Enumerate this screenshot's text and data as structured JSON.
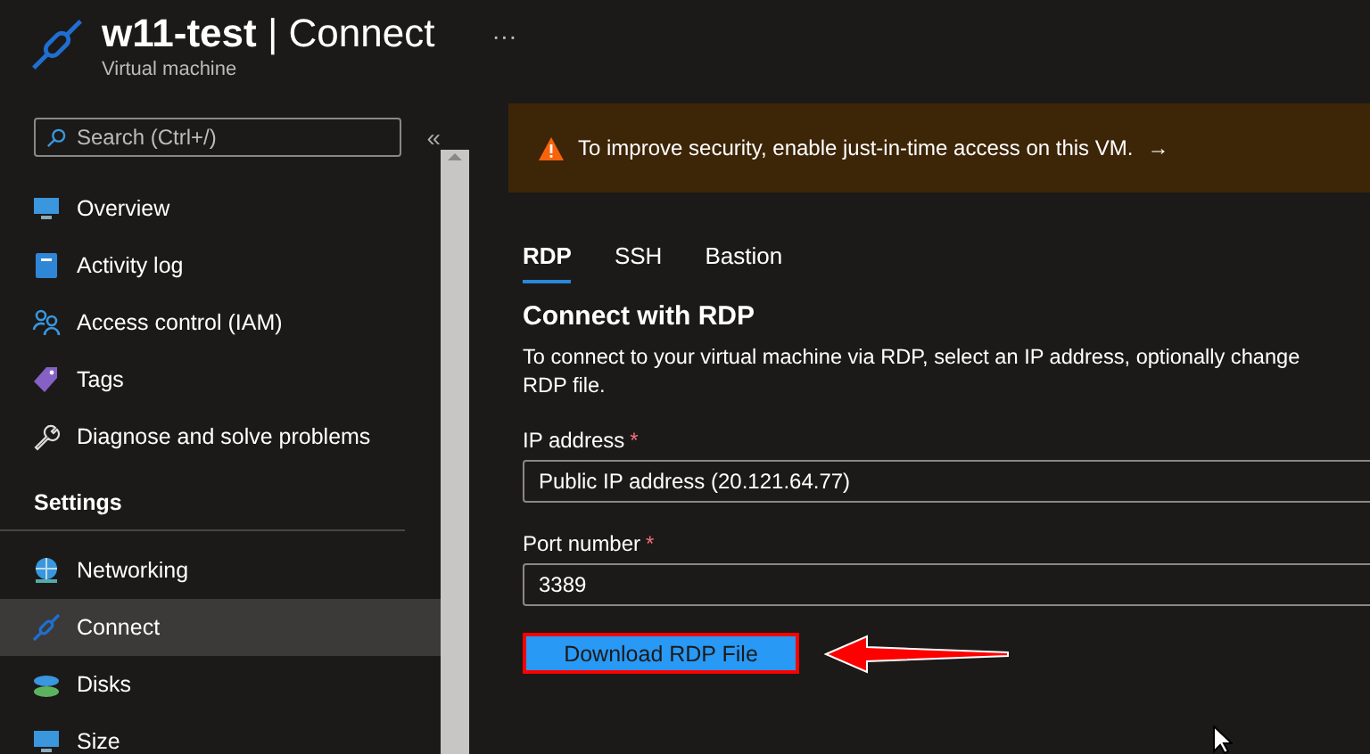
{
  "header": {
    "title": "w11-test",
    "separator": "|",
    "page": "Connect",
    "subtitle": "Virtual machine",
    "more": "···"
  },
  "sidebar": {
    "search": {
      "placeholder": "Search (Ctrl+/)"
    },
    "collapse": "«",
    "items": [
      {
        "kind": "item",
        "label": "Overview",
        "selected": false
      },
      {
        "kind": "item",
        "label": "Activity log",
        "selected": false
      },
      {
        "kind": "item",
        "label": "Access control (IAM)",
        "selected": false
      },
      {
        "kind": "item",
        "label": "Tags",
        "selected": false
      },
      {
        "kind": "item",
        "label": "Diagnose and solve problems",
        "selected": false
      },
      {
        "kind": "heading",
        "label": "Settings"
      },
      {
        "kind": "item",
        "label": "Networking",
        "selected": false
      },
      {
        "kind": "item",
        "label": "Connect",
        "selected": true
      },
      {
        "kind": "item",
        "label": "Disks",
        "selected": false
      },
      {
        "kind": "item",
        "label": "Size",
        "selected": false
      }
    ]
  },
  "banner": {
    "text": "To improve security, enable just-in-time access on this VM.",
    "arrow": "→"
  },
  "tabs": [
    {
      "label": "RDP",
      "selected": true
    },
    {
      "label": "SSH",
      "selected": false
    },
    {
      "label": "Bastion",
      "selected": false
    }
  ],
  "section": {
    "title": "Connect with RDP",
    "description_lines": [
      "To connect to your virtual machine via RDP, select an IP address, optionally change",
      "RDP file."
    ]
  },
  "fields": [
    {
      "label": "IP address",
      "required_mark": "*",
      "value": "Public IP address (20.121.64.77)"
    },
    {
      "label": "Port number",
      "required_mark": "*",
      "value": "3389"
    }
  ],
  "download_button": {
    "label": "Download RDP File",
    "highlighted": true
  }
}
